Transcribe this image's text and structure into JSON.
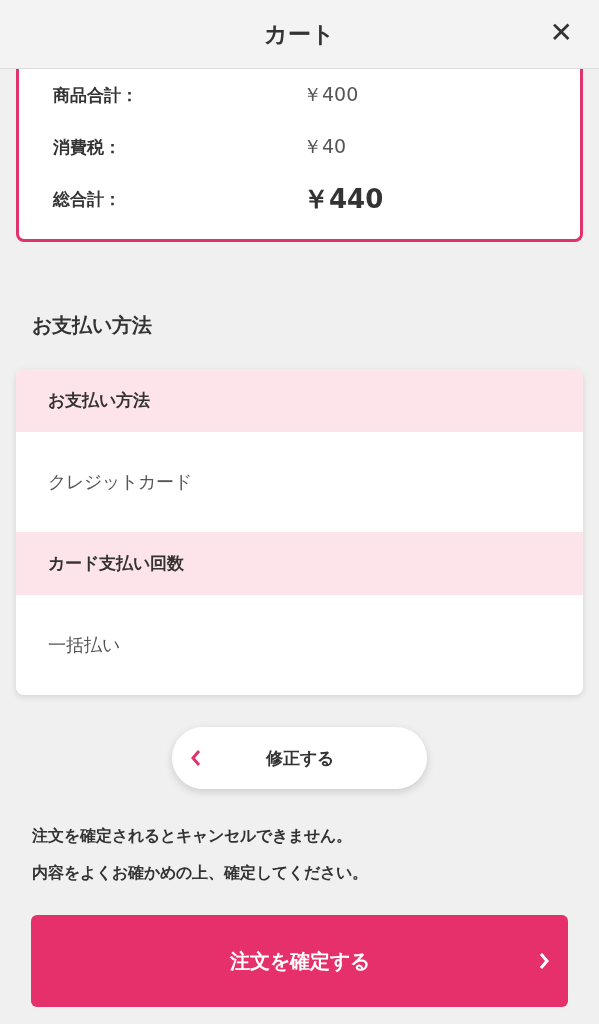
{
  "header": {
    "title": "カート",
    "close": "✕"
  },
  "summary": [
    {
      "label": "商品合計：",
      "value": "￥400",
      "emphasis": false
    },
    {
      "label": "消費税：",
      "value": "￥40",
      "emphasis": false
    },
    {
      "label": "総合計：",
      "value": "￥440",
      "emphasis": true
    }
  ],
  "payment_section": {
    "heading": "お支払い方法",
    "rows": [
      {
        "kind": "header",
        "text": "お支払い方法"
      },
      {
        "kind": "value",
        "text": "クレジットカード"
      },
      {
        "kind": "header",
        "text": "カード支払い回数"
      },
      {
        "kind": "value",
        "text": "一括払い"
      }
    ]
  },
  "edit_button": {
    "label": "修正する"
  },
  "notice": [
    "注文を確定されるとキャンセルできません。",
    "内容をよくお確かめの上、確定してください。"
  ],
  "confirm_button": {
    "label": "注文を確定する"
  }
}
